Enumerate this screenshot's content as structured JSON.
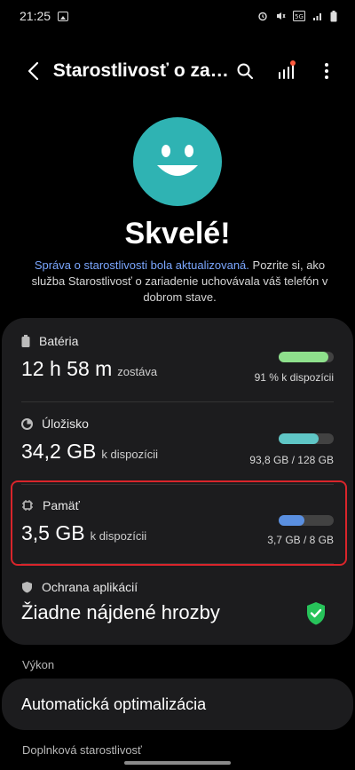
{
  "status_bar": {
    "time": "21:25",
    "icons": [
      "gallery-icon",
      "alarm-icon",
      "mute-icon",
      "5g-icon",
      "signal-icon",
      "battery-icon"
    ]
  },
  "app_bar": {
    "title": "Starostlivosť o zaria...",
    "actions": [
      "search-icon",
      "stats-icon",
      "more-icon"
    ]
  },
  "hero": {
    "headline": "Skvelé!",
    "desc_link": "Správa o starostlivosti bola aktualizovaná.",
    "desc_rest": " Pozrite si, ako služba Starostlivosť o zariadenie uchovávala váš telefón v dobrom stave."
  },
  "sections": {
    "battery": {
      "label": "Batéria",
      "value_big": "12 h 58 m",
      "value_small": "zostáva",
      "right": "91 % k dispozícii",
      "fill": 0.91,
      "color": "#8ee08c"
    },
    "storage": {
      "label": "Úložisko",
      "value_big": "34,2 GB",
      "value_small": "k dispozícii",
      "right": "93,8 GB / 128 GB",
      "fill": 0.73,
      "color": "#5fc6c6"
    },
    "memory": {
      "label": "Pamäť",
      "value_big": "3,5 GB",
      "value_small": "k dispozícii",
      "right": "3,7 GB / 8 GB",
      "fill": 0.46,
      "color": "#5a8fe0"
    },
    "app_protection": {
      "label": "Ochrana aplikácií",
      "value_big": "Žiadne nájdené hrozby",
      "shield_color": "#27c35a"
    }
  },
  "perf_label": "Výkon",
  "auto_opt": "Automatická optimalizácia",
  "extra_label": "Doplnková starostlivosť"
}
